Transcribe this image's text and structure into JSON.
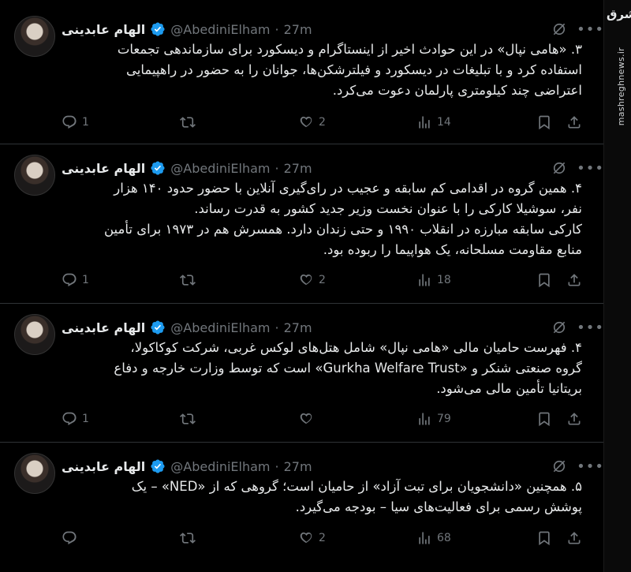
{
  "author": {
    "name": "الهام عابدینی",
    "handle": "@AbediniElham",
    "separator": "·",
    "verified": true
  },
  "colors": {
    "background": "#000000",
    "text": "#e7e9ea",
    "muted": "#71767b",
    "verified_badge": "#1d9bf0",
    "divider": "#2f3336"
  },
  "watermark": {
    "logo": "مشرق",
    "url": "mashreghnews.ir"
  },
  "tweets": [
    {
      "time": "27m",
      "lines": [
        "۳. «هامی نپال» در این حوادث اخیر از اینستاگرام و دیسکورد برای سازماندهی تجمعات",
        "استفاده کرد و با تبلیغات در دیسکورد و فیلترشکن‌ها، جوانان را به حضور در راهپیمایی",
        "اعتراضی چند کیلومتری پارلمان دعوت می‌کرد."
      ],
      "replies": "1",
      "retweets": "",
      "likes": "2",
      "views": "14"
    },
    {
      "time": "27m",
      "lines": [
        "۴. همین گروه در اقدامی کم سابقه و عجیب در رای‌گیری آنلاین با حضور حدود ۱۴۰ هزار",
        "نفر، سوشیلا کارکی را با عنوان نخست وزیر جدید کشور به قدرت رساند.",
        "کارکی سابقه مبارزه در انقلاب ۱۹۹۰ و حتی زندان دارد. همسرش هم در ۱۹۷۳ برای تأمین",
        "منابع مقاومت مسلحانه، یک هواپیما را ربوده بود."
      ],
      "replies": "1",
      "retweets": "",
      "likes": "2",
      "views": "18"
    },
    {
      "time": "27m",
      "lines": [
        "۴. فهرست حامیان مالی «هامی نپال» شامل هتل‌های لوکس غربی، شرکت کوکاکولا،",
        "گروه صنعتی شنکر و «Gurkha Welfare Trust» است که توسط وزارت خارجه و دفاع",
        "بریتانیا تأمین مالی می‌شود."
      ],
      "replies": "1",
      "retweets": "",
      "likes": "",
      "views": "79"
    },
    {
      "time": "27m",
      "lines": [
        "۵. همچنین «دانشجویان برای تبت آزاد» از حامیان است؛ گروهی که از «NED» – یک",
        "پوشش رسمی برای فعالیت‌های سیا – بودجه می‌گیرد."
      ],
      "replies": "",
      "retweets": "",
      "likes": "2",
      "views": "68"
    }
  ]
}
